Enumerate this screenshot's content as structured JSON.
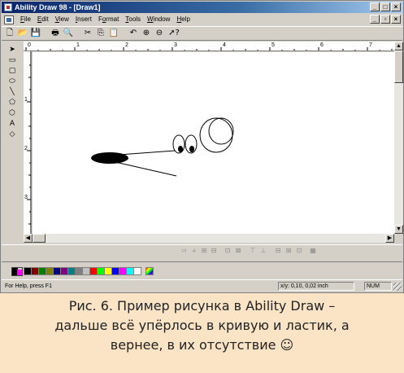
{
  "window": {
    "title": "Ability Draw 98 - [Draw1]",
    "controls": [
      "_",
      "□",
      "×"
    ],
    "child_controls": [
      "_",
      "▫",
      "×"
    ]
  },
  "menu": [
    {
      "label": "File",
      "mnemonic": "F"
    },
    {
      "label": "Edit",
      "mnemonic": "E"
    },
    {
      "label": "View",
      "mnemonic": "V"
    },
    {
      "label": "Insert",
      "mnemonic": "I"
    },
    {
      "label": "Format",
      "mnemonic": "o"
    },
    {
      "label": "Tools",
      "mnemonic": "T"
    },
    {
      "label": "Window",
      "mnemonic": "W"
    },
    {
      "label": "Help",
      "mnemonic": "H"
    }
  ],
  "toolbar": [
    {
      "name": "new-icon",
      "glyph": "🗋"
    },
    {
      "name": "open-icon",
      "glyph": "📂"
    },
    {
      "name": "save-icon",
      "glyph": "💾"
    },
    {
      "name": "print-icon",
      "glyph": "🖶"
    },
    {
      "name": "print-preview-icon",
      "glyph": "🔍"
    },
    {
      "name": "cut-icon",
      "glyph": "✂"
    },
    {
      "name": "copy-icon",
      "glyph": "⎘"
    },
    {
      "name": "paste-icon",
      "glyph": "📋"
    },
    {
      "name": "undo-icon",
      "glyph": "↶"
    },
    {
      "name": "zoom-in-icon",
      "glyph": "⊕"
    },
    {
      "name": "zoom-out-icon",
      "glyph": "⊖"
    },
    {
      "name": "context-help-icon",
      "glyph": "➚?"
    }
  ],
  "tools": [
    {
      "name": "select-tool-icon",
      "glyph": "➤"
    },
    {
      "name": "rectangle-tool-icon",
      "glyph": "▭"
    },
    {
      "name": "rounded-rectangle-tool-icon",
      "glyph": "▢"
    },
    {
      "name": "ellipse-tool-icon",
      "glyph": "⬭"
    },
    {
      "name": "line-tool-icon",
      "glyph": "╲"
    },
    {
      "name": "polygon-tool-icon",
      "glyph": "⬠"
    },
    {
      "name": "freehand-tool-icon",
      "glyph": "⬡"
    },
    {
      "name": "text-tool-icon",
      "glyph": "A"
    },
    {
      "name": "fill-tool-icon",
      "glyph": "◇"
    }
  ],
  "rulers": {
    "top_labels": [
      "0",
      "1",
      "2",
      "3",
      "4",
      "5",
      "6",
      "7"
    ],
    "left_labels": [
      "1",
      "2",
      "3"
    ]
  },
  "align_tools": [
    "⫤",
    "⫣",
    "⊞",
    "⊟",
    "⊡",
    "⊠",
    "⊤",
    "⊥",
    "⊟",
    "⊞",
    "⊡",
    "▦"
  ],
  "palette": {
    "foreground": "#000000",
    "background_swatch": "#ff00ff",
    "colors": [
      "#000000",
      "#800000",
      "#008000",
      "#808000",
      "#000080",
      "#800080",
      "#008080",
      "#808080",
      "#c0c0c0",
      "#ff0000",
      "#00ff00",
      "#ffff00",
      "#0000ff",
      "#ff00ff",
      "#00ffff",
      "#ffffff"
    ]
  },
  "status": {
    "help": "For Help, press F1",
    "coords": "x/y: 0,10, 0,02 inch",
    "num": "NUM"
  },
  "caption": {
    "line1": "Рис. 6. Пример рисунка в Ability Draw –",
    "line2": "дальше всё упёрлось в кривую и ластик, а",
    "line3": "вернее, в их отсутствие ☺"
  }
}
